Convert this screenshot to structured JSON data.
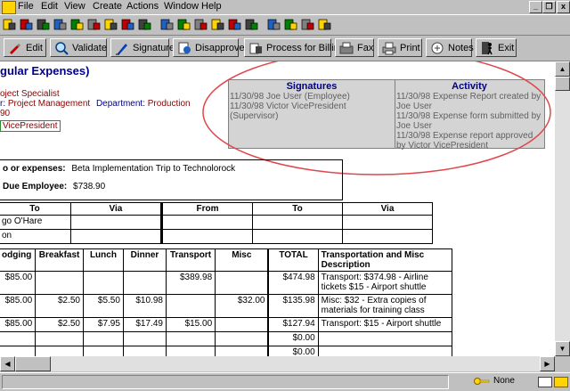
{
  "menu": {
    "items": [
      "File",
      "Edit",
      "View",
      "Create",
      "Actions",
      "Window",
      "Help"
    ],
    "window_buttons": [
      "_",
      "❐",
      "x"
    ]
  },
  "icons": [
    "open-icon",
    "check-icon",
    "scissors-icon",
    "copy-icon",
    "paste-icon",
    "document-icon",
    "spelling-icon",
    "pen-icon",
    "tools-icon",
    "move-down-icon",
    "move-up-icon",
    "arrow-down-icon",
    "arrow-up-icon",
    "star-down-icon",
    "star-up-icon",
    "sort-icon",
    "attach-icon",
    "people-icon",
    "linked-icon"
  ],
  "actions": [
    {
      "label": "Edit",
      "icon": "pencil-icon"
    },
    {
      "label": "Validate",
      "icon": "magnify-icon"
    },
    {
      "label": "Signature",
      "icon": "pen-icon"
    },
    {
      "label": "Disapprove",
      "icon": "disapprove-icon"
    },
    {
      "label": "Process for Billing",
      "icon": "billing-icon"
    },
    {
      "label": "Fax",
      "icon": "fax-icon"
    },
    {
      "label": "Print",
      "icon": "print-icon"
    },
    {
      "label": "Notes",
      "icon": "notes-icon"
    },
    {
      "label": "Exit",
      "icon": "exit-icon"
    }
  ],
  "form": {
    "title": "gular Expenses)",
    "role": "oject Specialist",
    "division_label": "r:",
    "division": "Project Management",
    "department_label": "Department:",
    "department": "Production",
    "amount_fragment": "90",
    "approver": "VicePresident"
  },
  "signatures": {
    "header": "Signatures",
    "entries": [
      "11/30/98  Joe User (Employee)",
      "11/30/98  Victor VicePresident (Supervisor)"
    ]
  },
  "activity": {
    "header": "Activity",
    "entries": [
      "11/30/98  Expense Report created by Joe User",
      "11/30/98  Expense form submitted by Joe User",
      "11/30/98  Expense report approved by Victor VicePresident"
    ]
  },
  "purpose": {
    "label": "o or expenses:",
    "value": "Beta Implementation Trip to Technolorock",
    "due_label": "Due Employee:",
    "due_value": "$738.90"
  },
  "travel": {
    "headers": [
      "To",
      "Via",
      "From",
      "To",
      "Via"
    ],
    "rows": [
      [
        "go O'Hare",
        "",
        "",
        "",
        ""
      ],
      [
        "on",
        "",
        "",
        "",
        ""
      ]
    ]
  },
  "expenses": {
    "headers": [
      "odging",
      "Breakfast",
      "Lunch",
      "Dinner",
      "Transport",
      "Misc",
      "TOTAL",
      "Transportation and Misc Description"
    ],
    "rows": [
      [
        "$85.00",
        "",
        "",
        "",
        "$389.98",
        "",
        "$474.98",
        "Transport: $374.98 - Airline tickets $15 - Airport shuttle"
      ],
      [
        "$85.00",
        "$2.50",
        "$5.50",
        "$10.98",
        "",
        "$32.00",
        "$135.98",
        "Misc: $32 - Extra copies of materials for training class"
      ],
      [
        "$85.00",
        "$2.50",
        "$7.95",
        "$17.49",
        "$15.00",
        "",
        "$127.94",
        "Transport: $15 - Airport shuttle"
      ],
      [
        "",
        "",
        "",
        "",
        "",
        "",
        "$0.00",
        ""
      ],
      [
        "",
        "",
        "",
        "",
        "",
        "",
        "$0.00",
        ""
      ]
    ]
  },
  "status": {
    "location": "None"
  },
  "colors": {
    "accent_title": "#00008b",
    "annotation_circle": "#e0474c"
  }
}
